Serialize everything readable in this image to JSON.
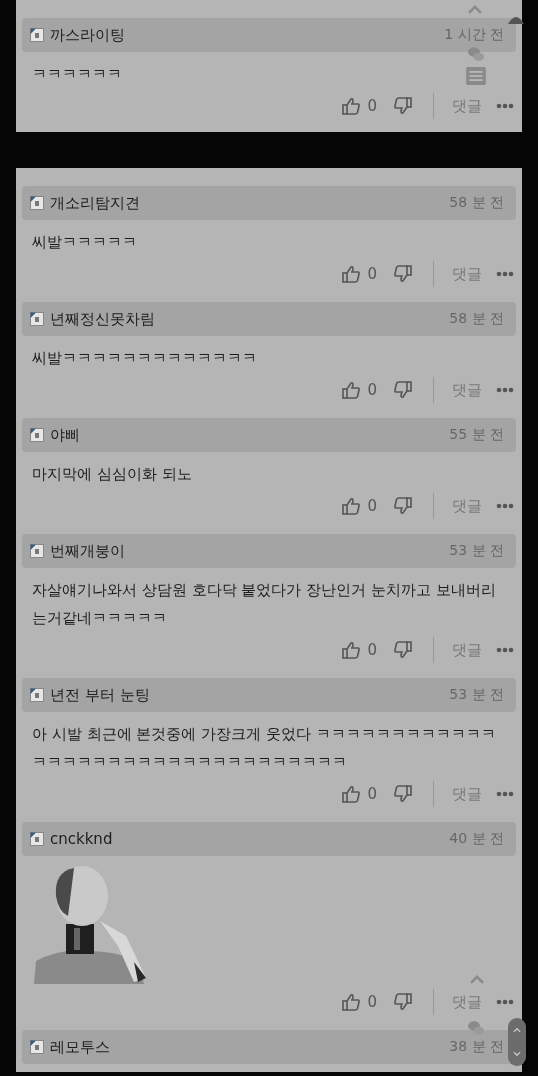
{
  "cards": [
    {
      "comments": [
        {
          "author": "까스라이팅",
          "time": "1 시간 전",
          "kind": "text",
          "body": "ㅋㅋㅋㅋㅋㅋ",
          "likes": "0",
          "reply": "댓글"
        }
      ]
    },
    {
      "comments": [
        {
          "author": "개소리탐지견",
          "time": "58 분 전",
          "kind": "text",
          "body": "씨발ㅋㅋㅋㅋㅋ",
          "likes": "0",
          "reply": "댓글"
        },
        {
          "author": "년째정신못차림",
          "time": "58 분 전",
          "kind": "text",
          "body": "씨발ㅋㅋㅋㅋㅋㅋㅋㅋㅋㅋㅋㅋㅋ",
          "likes": "0",
          "reply": "댓글"
        },
        {
          "author": "야삐",
          "time": "55 분 전",
          "kind": "text",
          "body": "마지막에 심심이화 되노",
          "likes": "0",
          "reply": "댓글"
        },
        {
          "author": "번째개붕이",
          "time": "53 분 전",
          "kind": "text",
          "body": "자살얘기나와서 상담원 호다닥 붙었다가 장난인거 눈치까고 보내버리는거같네ㅋㅋㅋㅋㅋ",
          "likes": "0",
          "reply": "댓글"
        },
        {
          "author": "년전 부터 눈팅",
          "time": "53 분 전",
          "kind": "text",
          "body": "아 시발 최근에 본것중에 가장크게 웃었다 ㅋㅋㅋㅋㅋㅋㅋㅋㅋㅋㅋㅋㅋㅋㅋㅋㅋㅋㅋㅋㅋㅋㅋㅋㅋㅋㅋㅋㅋㅋㅋㅋㅋ",
          "likes": "0",
          "reply": "댓글"
        },
        {
          "author": "cnckknd",
          "time": "40 분 전",
          "kind": "picture",
          "likes": "0",
          "reply": "댓글"
        },
        {
          "author": "레모투스",
          "time": "38 분 전"
        }
      ]
    }
  ]
}
